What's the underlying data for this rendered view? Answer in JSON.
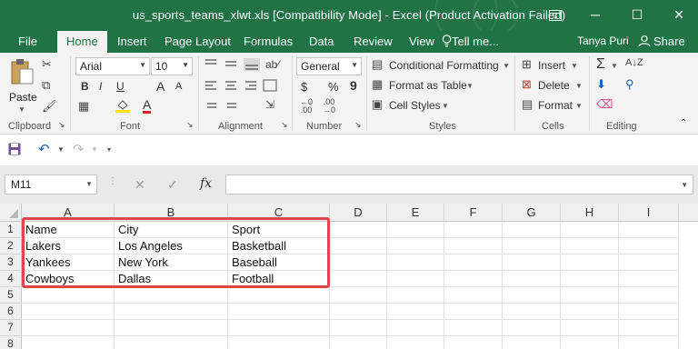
{
  "titlebar": {
    "title": "us_sports_teams_xlwt.xls  [Compatibility Mode] - Excel (Product Activation Failed)",
    "ribbon_display_icon": "ribbon-display-options-icon",
    "minimize": "─",
    "maximize": "☐",
    "close": "✕"
  },
  "tabs": {
    "items": [
      "File",
      "Home",
      "Insert",
      "Page Layout",
      "Formulas",
      "Data",
      "Review",
      "View"
    ],
    "active": "Home",
    "tell_me": "Tell me...",
    "user": "Tanya Puri",
    "share": "Share"
  },
  "ribbon": {
    "clipboard": {
      "paste": "Paste",
      "label": "Clipboard"
    },
    "font": {
      "family": "Arial",
      "size": "10",
      "bold": "B",
      "italic": "I",
      "underline": "U",
      "grow": "A",
      "shrink": "A",
      "font_color": "A",
      "label": "Font"
    },
    "alignment": {
      "label": "Alignment"
    },
    "number": {
      "format": "General",
      "currency": "$",
      "percent": "%",
      "comma": "9",
      "label": "Number"
    },
    "styles": {
      "conditional": "Conditional Formatting",
      "table": "Format as Table",
      "cell_styles": "Cell Styles",
      "label": "Styles"
    },
    "cells": {
      "insert": "Insert",
      "delete": "Delete",
      "format": "Format",
      "label": "Cells"
    },
    "editing": {
      "sum": "Σ",
      "label": "Editing"
    }
  },
  "formula_bar": {
    "name_box": "M11",
    "cancel": "✕",
    "enter": "✓",
    "fx": "fx",
    "value": ""
  },
  "grid": {
    "columns": [
      "A",
      "B",
      "C",
      "D",
      "E",
      "F",
      "G",
      "H",
      "I"
    ],
    "rows": [
      "1",
      "2",
      "3",
      "4",
      "5",
      "6",
      "7",
      "8"
    ],
    "cells": [
      [
        "Name",
        "City",
        "Sport"
      ],
      [
        "Lakers",
        "Los Angeles",
        "Basketball"
      ],
      [
        "Yankees",
        "New York",
        "Baseball"
      ],
      [
        "Cowboys",
        "Dallas",
        "Football"
      ]
    ]
  },
  "colors": {
    "excel_green": "#217346",
    "highlight_red": "#e0474c"
  }
}
